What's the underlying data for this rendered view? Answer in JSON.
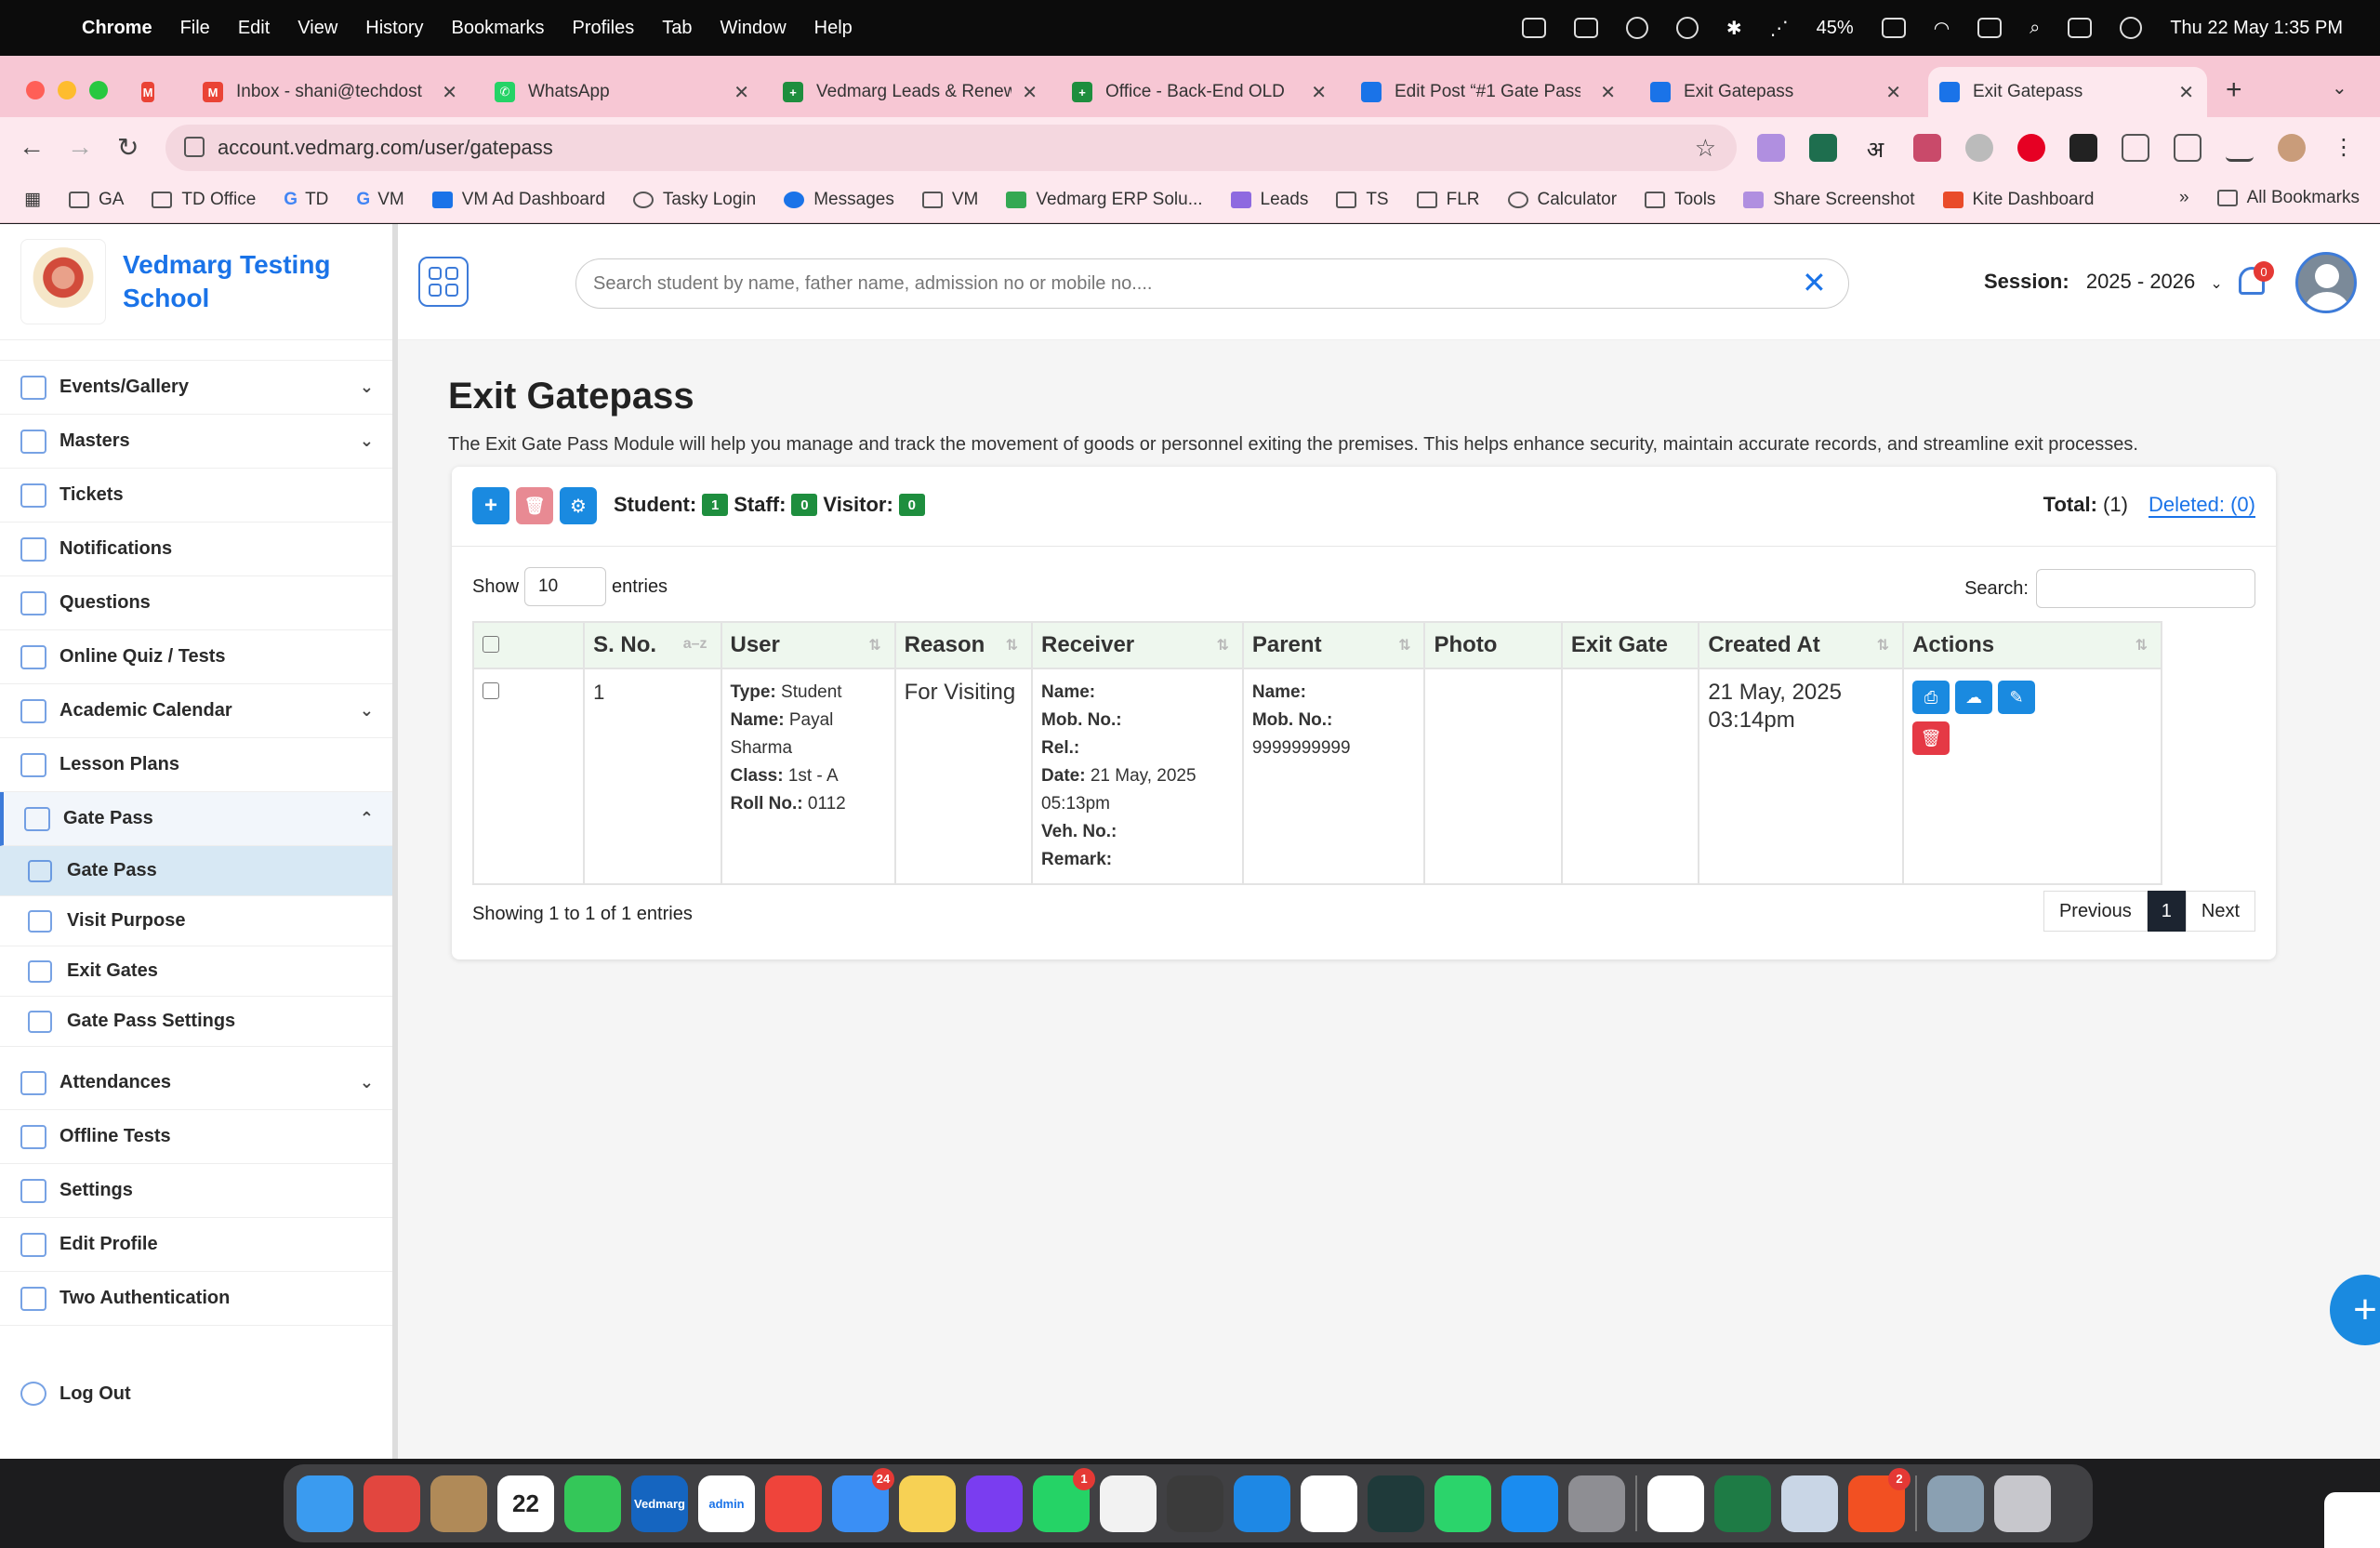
{
  "menubar": {
    "app": "Chrome",
    "items": [
      "File",
      "Edit",
      "View",
      "History",
      "Bookmarks",
      "Profiles",
      "Tab",
      "Window",
      "Help"
    ],
    "battery": "45%",
    "clock": "Thu 22 May  1:35 PM"
  },
  "tabs": [
    {
      "title": "",
      "favicon": "gmail-icon",
      "color": "#ea4335"
    },
    {
      "title": "Inbox - shani@techdost",
      "favicon": "gmail-icon",
      "color": "#ea4335"
    },
    {
      "title": "WhatsApp",
      "favicon": "whatsapp-icon",
      "color": "#25d366"
    },
    {
      "title": "Vedmarg Leads & Renew",
      "favicon": "sheets-icon",
      "color": "#1e8e3e"
    },
    {
      "title": "Office - Back-End OLD",
      "favicon": "sheets-icon",
      "color": "#1e8e3e"
    },
    {
      "title": "Edit Post “#1 Gate Pass",
      "favicon": "vedmarg-icon",
      "color": "#1a73e8"
    },
    {
      "title": "Exit Gatepass",
      "favicon": "vedmarg-icon",
      "color": "#1a73e8"
    },
    {
      "title": "Exit Gatepass",
      "favicon": "vedmarg-icon",
      "color": "#1a73e8",
      "active": true
    }
  ],
  "omnibox": {
    "url": "account.vedmarg.com/user/gatepass"
  },
  "bookmarks": [
    "GA",
    "TD Office",
    "TD",
    "VM",
    "VM Ad Dashboard",
    "Tasky Login",
    "Messages",
    "VM",
    "Vedmarg ERP Solu...",
    "Leads",
    "TS",
    "FLR",
    "Calculator",
    "Tools",
    "Share Screenshot",
    "Kite Dashboard"
  ],
  "bookmarks_more": "»",
  "all_bookmarks": "All Bookmarks",
  "brand": {
    "name": "Vedmarg Testing School"
  },
  "header": {
    "search_placeholder": "Search student by name, father name, admission no or mobile no....",
    "session_label": "Session:",
    "session_value": "2025 - 2026",
    "notification_count": "0"
  },
  "sidebar": {
    "items": [
      {
        "label": "Events/Gallery",
        "chevron": "⌄"
      },
      {
        "label": "Masters",
        "chevron": "⌄"
      },
      {
        "label": "Tickets",
        "chevron": ""
      },
      {
        "label": "Notifications",
        "chevron": ""
      },
      {
        "label": "Questions",
        "chevron": ""
      },
      {
        "label": "Online Quiz / Tests",
        "chevron": ""
      },
      {
        "label": "Academic Calendar",
        "chevron": "⌄"
      },
      {
        "label": "Lesson Plans",
        "chevron": ""
      },
      {
        "label": "Gate Pass",
        "chevron": "⌃"
      }
    ],
    "sub_items": [
      "Gate Pass",
      "Visit Purpose",
      "Exit Gates",
      "Gate Pass Settings"
    ],
    "items_after": [
      {
        "label": "Attendances",
        "chevron": "⌄"
      },
      {
        "label": "Offline Tests",
        "chevron": ""
      },
      {
        "label": "Settings",
        "chevron": ""
      },
      {
        "label": "Edit Profile",
        "chevron": ""
      },
      {
        "label": "Two Authentication",
        "chevron": ""
      }
    ],
    "logout": "Log Out"
  },
  "page": {
    "title": "Exit Gatepass",
    "description": "The Exit Gate Pass Module will help you manage and track the movement of goods or personnel exiting the premises. This helps enhance security, maintain accurate records, and streamline exit processes."
  },
  "summary": {
    "student_label": "Student:",
    "student_count": "1",
    "staff_label": "Staff:",
    "staff_count": "0",
    "visitor_label": "Visitor:",
    "visitor_count": "0",
    "total_label": "Total:",
    "total_value": "(1)",
    "deleted_label": "Deleted: (0)"
  },
  "table_controls": {
    "show": "Show",
    "entries_value": "10",
    "entries": "entries",
    "search": "Search:"
  },
  "columns": [
    "S. No.",
    "User",
    "Reason",
    "Receiver",
    "Parent",
    "Photo",
    "Exit Gate",
    "Created At",
    "Actions"
  ],
  "sorter_first": "a–z",
  "rows": [
    {
      "sno": "1",
      "user": {
        "type_label": "Type:",
        "type": "Student",
        "name_label": "Name:",
        "name": "Payal Sharma",
        "class_label": "Class:",
        "class": "1st - A",
        "roll_label": "Roll No.:",
        "roll": "0112"
      },
      "reason": "For Visiting",
      "receiver": {
        "name_label": "Name:",
        "mob_label": "Mob. No.:",
        "rel_label": "Rel.:",
        "date_label": "Date:",
        "date": "21 May, 2025 05:13pm",
        "veh_label": "Veh. No.:",
        "remark_label": "Remark:"
      },
      "parent": {
        "name_label": "Name:",
        "mob_label": "Mob. No.:",
        "mob": "9999999999"
      },
      "photo": "",
      "exit_gate": "",
      "created_at": "21 May, 2025 03:14pm"
    }
  ],
  "footer": {
    "info": "Showing 1 to 1 of 1 entries",
    "previous": "Previous",
    "page": "1",
    "next": "Next"
  },
  "colors": {
    "accent": "#1a73e8",
    "success": "#1e8e3e",
    "danger": "#e53935",
    "tab_strip": "#f7c7d4"
  },
  "dock": [
    {
      "name": "finder-icon",
      "color": "#3a9bf0"
    },
    {
      "name": "creative-cloud-icon",
      "color": "#e2463f"
    },
    {
      "name": "contacts-icon",
      "color": "#b08a58"
    },
    {
      "name": "calendar-icon",
      "color": "#ffffff",
      "label": "22"
    },
    {
      "name": "facetime-icon",
      "color": "#34c759"
    },
    {
      "name": "vedmarg-icon",
      "color": "#1565c0",
      "label": "Vedmarg"
    },
    {
      "name": "vedmarg-admin-icon",
      "color": "#ffffff",
      "label": "admin"
    },
    {
      "name": "anydesk-icon",
      "color": "#ef443b"
    },
    {
      "name": "mail-icon",
      "color": "#3a8ff5",
      "badge": "24"
    },
    {
      "name": "notes-icon",
      "color": "#f7d154"
    },
    {
      "name": "firefox-icon",
      "color": "#7a3df0"
    },
    {
      "name": "whatsapp-icon",
      "color": "#25d366",
      "badge": "1"
    },
    {
      "name": "chrome-icon",
      "color": "#f2f2f2"
    },
    {
      "name": "sublime-icon",
      "color": "#3b3b3b"
    },
    {
      "name": "safari-icon",
      "color": "#1e88e5"
    },
    {
      "name": "opera-icon",
      "color": "#ffffff"
    },
    {
      "name": "filmora-icon",
      "color": "#1f3a3a"
    },
    {
      "name": "pen-icon",
      "color": "#2bd46b"
    },
    {
      "name": "app-store-icon",
      "color": "#1a8cf0"
    },
    {
      "name": "system-settings-icon",
      "color": "#8e8e93"
    },
    {
      "name": "windows-app-icon",
      "color": "#ffffff"
    },
    {
      "name": "excel-icon",
      "color": "#1e7b45"
    },
    {
      "name": "preview-icon",
      "color": "#c9d6e6"
    },
    {
      "name": "office-icon",
      "color": "#f25022",
      "badge": "2"
    },
    {
      "name": "image-capture-icon",
      "color": "#8aa0b2"
    },
    {
      "name": "trash-icon",
      "color": "#c7c7cc"
    }
  ]
}
